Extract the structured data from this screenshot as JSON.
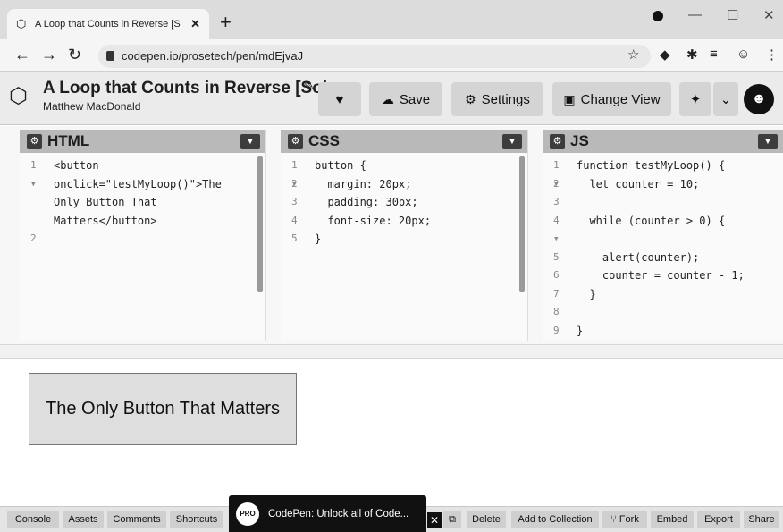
{
  "browser": {
    "tab_title": "A Loop that Counts in Reverse [S",
    "tab_close": "✕",
    "new_tab": "+",
    "url": "codepen.io/prosetech/pen/mdEjvaJ"
  },
  "header": {
    "title": "A Loop that Counts in Reverse [Sol...",
    "author": "Matthew MacDonald",
    "save_label": "Save",
    "settings_label": "Settings",
    "change_view_label": "Change View"
  },
  "panels": {
    "html": {
      "label": "HTML",
      "lines": [
        {
          "n": "1 ▾",
          "t": "<button"
        },
        {
          "n": "",
          "t": "onclick=\"testMyLoop()\">The"
        },
        {
          "n": "",
          "t": "Only Button That"
        },
        {
          "n": "",
          "t": "Matters</button>"
        },
        {
          "n": "2",
          "t": ""
        }
      ]
    },
    "css": {
      "label": "CSS",
      "lines": [
        {
          "n": "1 ▾",
          "t": "button {"
        },
        {
          "n": "2",
          "t": "  margin: 20px;"
        },
        {
          "n": "3",
          "t": "  padding: 30px;"
        },
        {
          "n": "4",
          "t": "  font-size: 20px;"
        },
        {
          "n": "5",
          "t": "}"
        }
      ]
    },
    "js": {
      "label": "JS",
      "lines": [
        {
          "n": "1 ▾",
          "t": "function testMyLoop() {"
        },
        {
          "n": "2",
          "t": "  let counter = 10;"
        },
        {
          "n": "3",
          "t": ""
        },
        {
          "n": "4 ▾",
          "t": "  while (counter > 0) {"
        },
        {
          "n": "",
          "t": ""
        },
        {
          "n": "5",
          "t": "    alert(counter);"
        },
        {
          "n": "6",
          "t": "    counter = counter - 1;"
        },
        {
          "n": "7",
          "t": "  }"
        },
        {
          "n": "8",
          "t": ""
        },
        {
          "n": "9",
          "t": "}"
        }
      ]
    }
  },
  "preview": {
    "button_label": "The Only Button That Matters"
  },
  "footer": {
    "console": "Console",
    "assets": "Assets",
    "comments": "Comments",
    "shortcuts": "Shortcuts",
    "promo_badge": "PRO",
    "promo_text": "CodePen: Unlock all of Code...",
    "delete": "Delete",
    "add_to_collection": "Add to Collection",
    "fork": "Fork",
    "embed": "Embed",
    "export": "Export",
    "share": "Share"
  }
}
